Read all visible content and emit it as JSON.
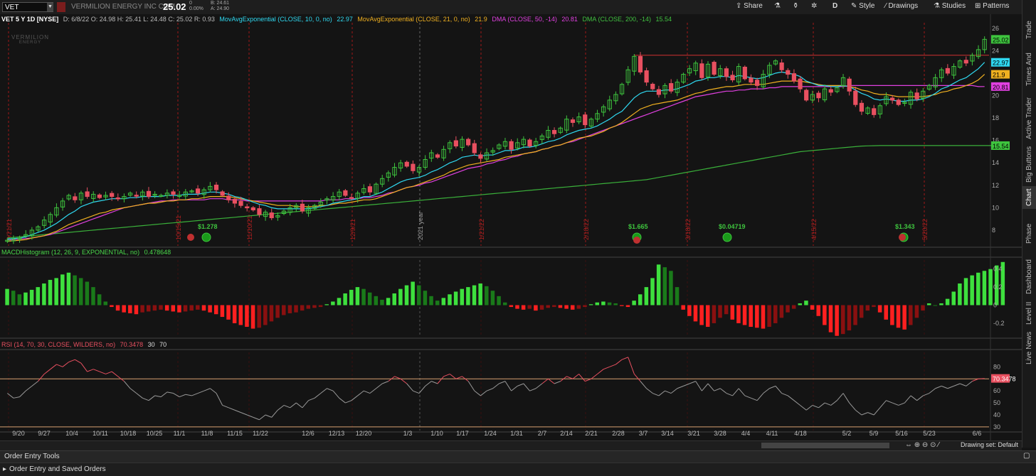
{
  "toolbar": {
    "symbol": "VET",
    "company": "VERMILION ENERGY INC COM",
    "last": "25.02",
    "change": "0",
    "change_pct": "0.00%",
    "bid": "B: 24.61",
    "ask": "A: 24.90",
    "share": "Share",
    "period": "D",
    "style": "Style",
    "drawings": "Drawings",
    "studies": "Studies",
    "patterns": "Patterns"
  },
  "right_tabs": [
    "Trade",
    "Times And Sales",
    "Active Trader",
    "Big Buttons",
    "Chart",
    "Phase Scores",
    "Dashboard",
    "Level II",
    "Live News"
  ],
  "price_header": {
    "title": "VET 5 Y 1D [NYSE]",
    "ohlc": "D: 6/8/22  O: 24.98  H: 25.41  L: 24.48  C: 25.02  R: 0.93",
    "ema10": {
      "label": "MovAvgExponential (CLOSE, 10, 0, no)",
      "value": "22.97",
      "color": "#2fd8f0"
    },
    "ema21": {
      "label": "MovAvgExponential (CLOSE, 21, 0, no)",
      "value": "21.9",
      "color": "#f0b020"
    },
    "dma50": {
      "label": "DMA (CLOSE, 50, -14)",
      "value": "20.81",
      "color": "#e040e0"
    },
    "dma200": {
      "label": "DMA (CLOSE, 200, -14)",
      "value": "15.54",
      "color": "#40c040"
    }
  },
  "macd_header": {
    "label": "MACDHistogram (12, 26, 9, EXPONENTIAL, no)",
    "value": "0.478648"
  },
  "rsi_header": {
    "label": "RSI (14, 70, 30, CLOSE, WILDERS, no)",
    "value": "70.3478",
    "ob": "30",
    "os": "70"
  },
  "watermark": {
    "line1": "VERMILION",
    "line2": "ENERGY"
  },
  "colors": {
    "up": "#3ec43e",
    "down": "#e85060",
    "bg": "#141414",
    "grid": "#2a2a2a",
    "marker": "#a01818"
  },
  "chart_data": {
    "type": "candlestick",
    "price_axis": [
      8,
      10,
      12,
      14,
      16,
      18,
      20,
      22,
      24,
      26
    ],
    "price_ylim": [
      6.6,
      26.5
    ],
    "last_price_label": "25.02",
    "resistance_line": 23.6,
    "x_ticks": [
      "9/20",
      "9/27",
      "10/4",
      "10/11",
      "10/18",
      "10/25",
      "11/1",
      "11/8",
      "11/15",
      "11/22",
      "12/6",
      "12/13",
      "12/20",
      "1/3",
      "1/10",
      "1/17",
      "1/24",
      "1/31",
      "2/7",
      "2/14",
      "2/21",
      "2/28",
      "3/7",
      "3/14",
      "3/21",
      "3/28",
      "4/4",
      "4/11",
      "4/18",
      "5/2",
      "5/9",
      "5/16",
      "5/23",
      "6/6"
    ],
    "vertical_markers": [
      "9/21/21",
      "10/15/21",
      "11/10/21",
      "12/9/21",
      "2021 year",
      "1/21/22",
      "2/18/22",
      "3/18/22",
      "4/15/22",
      "5/20/22"
    ],
    "dividends": [
      "$1.278",
      "$1.665",
      "$0.04719",
      "$1.343"
    ],
    "closes": [
      7.1,
      7.2,
      7.3,
      7.6,
      8.0,
      8.3,
      8.9,
      9.4,
      10.0,
      10.6,
      11.1,
      10.7,
      11.3,
      11.0,
      11.2,
      10.9,
      11.1,
      11.0,
      10.8,
      11.0,
      11.3,
      11.1,
      11.4,
      11.0,
      11.2,
      11.1,
      11.3,
      11.2,
      11.1,
      11.4,
      11.5,
      11.3,
      11.6,
      11.9,
      11.6,
      11.1,
      10.7,
      10.4,
      10.2,
      10.0,
      9.8,
      9.4,
      9.6,
      9.1,
      9.3,
      9.7,
      10.0,
      10.2,
      9.7,
      10.0,
      10.2,
      10.5,
      10.8,
      11.0,
      11.4,
      11.1,
      10.9,
      11.3,
      11.7,
      11.4,
      12.1,
      12.6,
      13.1,
      13.6,
      14.0,
      13.7,
      13.3,
      13.6,
      14.3,
      14.9,
      14.5,
      15.2,
      15.8,
      15.5,
      16.1,
      15.6,
      14.9,
      14.4,
      14.9,
      15.1,
      15.6,
      15.9,
      15.2,
      15.8,
      16.1,
      15.5,
      15.9,
      16.4,
      16.9,
      16.6,
      17.1,
      17.9,
      17.6,
      18.1,
      17.4,
      17.9,
      18.4,
      19.0,
      19.6,
      20.1,
      21.0,
      22.3,
      23.5,
      22.1,
      21.2,
      20.6,
      20.1,
      20.9,
      20.4,
      21.2,
      21.9,
      22.4,
      22.9,
      21.6,
      22.8,
      21.9,
      22.4,
      21.7,
      21.4,
      22.6,
      21.5,
      21.2,
      20.9,
      21.9,
      22.7,
      23.1,
      22.3,
      21.9,
      21.3,
      20.6,
      19.6,
      20.1,
      19.8,
      20.6,
      20.3,
      20.7,
      21.6,
      20.4,
      19.2,
      18.6,
      18.9,
      18.3,
      19.1,
      19.9,
      19.6,
      19.2,
      19.4,
      20.3,
      19.7,
      20.4,
      20.9,
      21.6,
      22.3,
      22.0,
      22.6,
      23.1,
      22.9,
      23.6,
      24.1,
      25.02
    ],
    "ema10": [
      7.2,
      7.25,
      7.3,
      7.4,
      7.6,
      7.8,
      8.0,
      8.3,
      8.6,
      9.0,
      9.4,
      9.7,
      10.1,
      10.3,
      10.5,
      10.6,
      10.7,
      10.8,
      10.8,
      10.8,
      10.9,
      10.9,
      11.0,
      11.0,
      11.0,
      11.0,
      11.1,
      11.1,
      11.1,
      11.2,
      11.2,
      11.2,
      11.3,
      11.4,
      11.4,
      11.3,
      11.2,
      11.0,
      10.9,
      10.7,
      10.5,
      10.3,
      10.2,
      10.0,
      9.9,
      9.9,
      9.9,
      9.9,
      9.9,
      9.9,
      10.0,
      10.1,
      10.2,
      10.4,
      10.5,
      10.6,
      10.7,
      10.8,
      11.0,
      11.0,
      11.2,
      11.4,
      11.7,
      12.0,
      12.3,
      12.5,
      12.6,
      12.7,
      12.9,
      13.2,
      13.4,
      13.7,
      14.0,
      14.2,
      14.5,
      14.6,
      14.7,
      14.6,
      14.7,
      14.7,
      14.9,
      15.1,
      15.1,
      15.2,
      15.4,
      15.4,
      15.5,
      15.7,
      15.9,
      16.0,
      16.2,
      16.5,
      16.7,
      16.9,
      17.0,
      17.1,
      17.3,
      17.6,
      17.9,
      18.3,
      18.6,
      19.2,
      19.8,
      20.2,
      20.4,
      20.4,
      20.4,
      20.5,
      20.5,
      20.6,
      20.8,
      21.0,
      21.3,
      21.4,
      21.6,
      21.6,
      21.7,
      21.7,
      21.6,
      21.8,
      21.7,
      21.6,
      21.5,
      21.6,
      21.8,
      22.0,
      22.1,
      22.0,
      21.9,
      21.7,
      21.3,
      21.1,
      20.9,
      20.9,
      20.8,
      20.8,
      20.9,
      20.8,
      20.5,
      20.2,
      20.0,
      19.7,
      19.6,
      19.7,
      19.6,
      19.5,
      19.5,
      19.6,
      19.6,
      19.7,
      19.9,
      20.2,
      20.6,
      20.8,
      21.1,
      21.4,
      21.6,
      22.0,
      22.4,
      22.97
    ],
    "ema21": [
      7.0,
      7.05,
      7.1,
      7.15,
      7.3,
      7.4,
      7.5,
      7.7,
      7.9,
      8.2,
      8.5,
      8.7,
      8.9,
      9.1,
      9.3,
      9.5,
      9.6,
      9.8,
      9.9,
      10.0,
      10.1,
      10.2,
      10.3,
      10.4,
      10.4,
      10.5,
      10.6,
      10.6,
      10.7,
      10.7,
      10.8,
      10.8,
      10.9,
      11.0,
      11.0,
      11.0,
      11.0,
      10.9,
      10.8,
      10.7,
      10.6,
      10.5,
      10.4,
      10.3,
      10.2,
      10.2,
      10.2,
      10.1,
      10.1,
      10.1,
      10.1,
      10.2,
      10.2,
      10.3,
      10.4,
      10.4,
      10.5,
      10.6,
      10.7,
      10.7,
      10.8,
      11.0,
      11.2,
      11.4,
      11.6,
      11.8,
      11.9,
      12.1,
      12.3,
      12.5,
      12.7,
      12.9,
      13.2,
      13.4,
      13.6,
      13.8,
      13.9,
      14.0,
      14.1,
      14.2,
      14.3,
      14.5,
      14.6,
      14.7,
      14.8,
      14.9,
      15.0,
      15.2,
      15.3,
      15.5,
      15.6,
      15.8,
      16.0,
      16.2,
      16.3,
      16.4,
      16.6,
      16.8,
      17.1,
      17.3,
      17.6,
      18.0,
      18.4,
      18.8,
      19.0,
      19.2,
      19.3,
      19.4,
      19.5,
      19.6,
      19.8,
      20.0,
      20.2,
      20.3,
      20.5,
      20.6,
      20.7,
      20.8,
      20.8,
      20.9,
      21.0,
      21.0,
      21.0,
      21.0,
      21.1,
      21.2,
      21.3,
      21.3,
      21.3,
      21.3,
      21.2,
      21.1,
      21.0,
      20.9,
      20.9,
      20.9,
      20.9,
      20.8,
      20.7,
      20.5,
      20.4,
      20.2,
      20.1,
      20.1,
      20.0,
      19.9,
      19.9,
      19.9,
      19.9,
      19.9,
      20.0,
      20.1,
      20.3,
      20.4,
      20.6,
      20.7,
      20.9,
      21.1,
      21.4,
      21.9
    ],
    "dma50": [
      7.1,
      7.15,
      7.2,
      7.25,
      7.3,
      7.4,
      7.5,
      7.6,
      7.8,
      8.0,
      8.2,
      8.4,
      8.6,
      8.8,
      9.0,
      9.2,
      9.4,
      9.6,
      9.8,
      10.0,
      10.1,
      10.2,
      10.3,
      10.4,
      10.5,
      10.6,
      10.6,
      10.7,
      10.7,
      10.7,
      10.7,
      10.7,
      10.7,
      10.8,
      10.8,
      10.8,
      10.7,
      10.7,
      10.7,
      10.6,
      10.6,
      10.6,
      10.6,
      10.6,
      10.6,
      10.6,
      10.6,
      10.6,
      10.6,
      10.6,
      10.6,
      10.6,
      10.7,
      10.7,
      10.7,
      10.8,
      10.8,
      10.8,
      10.9,
      10.9,
      11.0,
      11.1,
      11.3,
      11.4,
      11.6,
      11.8,
      11.9,
      12.0,
      12.2,
      12.3,
      12.5,
      12.7,
      12.9,
      13.1,
      13.3,
      13.5,
      13.6,
      13.7,
      13.9,
      14.0,
      14.2,
      14.3,
      14.5,
      14.6,
      14.8,
      14.9,
      15.0,
      15.2,
      15.3,
      15.5,
      15.6,
      15.8,
      15.9,
      16.1,
      16.3,
      16.5,
      16.7,
      16.9,
      17.1,
      17.3,
      17.5,
      17.7,
      17.9,
      18.1,
      18.3,
      18.5,
      18.7,
      18.9,
      19.1,
      19.3,
      19.5,
      19.7,
      19.9,
      20.0,
      20.1,
      20.2,
      20.3,
      20.4,
      20.4,
      20.5,
      20.5,
      20.6,
      20.6,
      20.6,
      20.7,
      20.7,
      20.8,
      20.8,
      20.8,
      20.8,
      20.8,
      20.8,
      20.8,
      20.8,
      20.8,
      20.8,
      20.8,
      20.9,
      20.9,
      20.9,
      20.9,
      20.9,
      20.9,
      20.9,
      20.9,
      20.9,
      20.9,
      20.9,
      20.9,
      20.9,
      20.9,
      20.9,
      20.9,
      20.9,
      20.9,
      20.9,
      20.9,
      20.9,
      20.8,
      20.81
    ],
    "dma200": [
      7.3,
      7.35,
      7.4,
      7.45,
      7.5,
      7.55,
      7.6,
      7.65,
      7.7,
      7.75,
      7.8,
      7.85,
      7.9,
      7.95,
      8.0,
      8.05,
      8.1,
      8.15,
      8.2,
      8.25,
      8.3,
      8.35,
      8.4,
      8.45,
      8.5,
      8.55,
      8.6,
      8.65,
      8.7,
      8.75,
      8.8,
      8.85,
      8.9,
      8.95,
      9.0,
      9.05,
      9.1,
      9.15,
      9.2,
      9.25,
      9.3,
      9.35,
      9.4,
      9.45,
      9.5,
      9.55,
      9.6,
      9.65,
      9.7,
      9.75,
      9.8,
      9.85,
      9.9,
      9.95,
      10.0,
      10.05,
      10.1,
      10.15,
      10.2,
      10.25,
      10.3,
      10.35,
      10.4,
      10.45,
      10.5,
      10.55,
      10.6,
      10.65,
      10.7,
      10.75,
      10.8,
      10.85,
      10.9,
      10.95,
      11.0,
      11.05,
      11.1,
      11.15,
      11.2,
      11.25,
      11.3,
      11.35,
      11.4,
      11.45,
      11.5,
      11.55,
      11.6,
      11.65,
      11.7,
      11.75,
      11.8,
      11.85,
      11.9,
      11.95,
      12.0,
      12.05,
      12.1,
      12.15,
      12.2,
      12.25,
      12.3,
      12.35,
      12.4,
      12.45,
      12.5,
      12.6,
      12.7,
      12.8,
      12.9,
      13.0,
      13.1,
      13.2,
      13.3,
      13.4,
      13.5,
      13.6,
      13.7,
      13.8,
      13.9,
      14.0,
      14.1,
      14.2,
      14.3,
      14.4,
      14.5,
      14.6,
      14.7,
      14.8,
      14.9,
      15.0,
      15.05,
      15.1,
      15.15,
      15.2,
      15.25,
      15.3,
      15.35,
      15.4,
      15.45,
      15.5,
      15.52,
      15.53,
      15.54,
      15.54,
      15.54,
      15.54,
      15.54,
      15.54,
      15.54,
      15.54,
      15.54,
      15.54,
      15.54,
      15.54,
      15.54,
      15.54,
      15.54,
      15.54,
      15.54,
      15.54,
      15.54,
      15.54
    ],
    "macd_axis": [
      0.4,
      0.2,
      0,
      -0.2
    ],
    "macd_ylim": [
      -0.35,
      0.5
    ],
    "macd_last": "0.478648",
    "macd_hist": [
      0.18,
      0.16,
      0.12,
      0.14,
      0.17,
      0.2,
      0.24,
      0.28,
      0.3,
      0.34,
      0.36,
      0.33,
      0.3,
      0.26,
      0.2,
      0.12,
      0.04,
      -0.02,
      -0.06,
      -0.08,
      -0.09,
      -0.1,
      -0.08,
      -0.07,
      -0.06,
      -0.05,
      -0.06,
      -0.07,
      -0.08,
      -0.07,
      -0.06,
      -0.05,
      -0.06,
      -0.08,
      -0.1,
      -0.13,
      -0.16,
      -0.2,
      -0.22,
      -0.24,
      -0.26,
      -0.25,
      -0.22,
      -0.18,
      -0.14,
      -0.11,
      -0.09,
      -0.08,
      -0.06,
      -0.04,
      -0.03,
      -0.02,
      0.01,
      0.04,
      0.08,
      0.13,
      0.17,
      0.2,
      0.18,
      0.14,
      0.1,
      0.06,
      0.08,
      0.13,
      0.18,
      0.22,
      0.26,
      0.22,
      0.16,
      0.1,
      0.05,
      0.08,
      0.12,
      0.15,
      0.18,
      0.2,
      0.22,
      0.24,
      0.21,
      0.16,
      0.1,
      0.03,
      -0.02,
      -0.04,
      -0.05,
      -0.04,
      -0.06,
      -0.05,
      -0.03,
      -0.02,
      -0.03,
      -0.04,
      -0.05,
      -0.04,
      -0.02,
      0.01,
      0.03,
      0.04,
      0.03,
      0.02,
      -0.01,
      -0.02,
      0.05,
      0.12,
      0.2,
      0.3,
      0.45,
      0.42,
      0.38,
      0.2,
      -0.05,
      -0.12,
      -0.18,
      -0.22,
      -0.24,
      -0.2,
      -0.14,
      -0.1,
      -0.16,
      -0.2,
      -0.22,
      -0.24,
      -0.25,
      -0.26,
      -0.24,
      -0.2,
      -0.14,
      -0.08,
      -0.04,
      0.02,
      0.05,
      -0.05,
      -0.12,
      -0.22,
      -0.3,
      -0.34,
      -0.32,
      -0.28,
      -0.22,
      -0.14,
      -0.06,
      -0.02,
      -0.08,
      -0.16,
      -0.22,
      -0.25,
      -0.27,
      -0.22,
      -0.14,
      -0.06,
      0.02,
      0.0,
      0.02,
      0.07,
      0.15,
      0.24,
      0.3,
      0.33,
      0.36,
      0.38,
      0.4,
      0.44,
      0.478
    ],
    "rsi_axis": [
      80,
      70,
      60,
      50,
      40,
      30
    ],
    "rsi_ylim": [
      27,
      92
    ],
    "rsi_last": "70.3478",
    "rsi": [
      58,
      54,
      55,
      60,
      64,
      68,
      74,
      78,
      82,
      80,
      84,
      86,
      83,
      76,
      78,
      76,
      74,
      76,
      72,
      68,
      62,
      58,
      54,
      52,
      56,
      55,
      59,
      58,
      55,
      57,
      56,
      58,
      60,
      62,
      58,
      48,
      46,
      44,
      42,
      40,
      38,
      36,
      40,
      38,
      44,
      48,
      46,
      50,
      46,
      52,
      54,
      58,
      62,
      60,
      54,
      50,
      52,
      56,
      60,
      58,
      62,
      66,
      68,
      72,
      70,
      66,
      60,
      58,
      64,
      68,
      66,
      72,
      74,
      70,
      72,
      68,
      60,
      56,
      60,
      62,
      66,
      68,
      60,
      64,
      66,
      60,
      62,
      66,
      70,
      66,
      68,
      72,
      70,
      74,
      68,
      70,
      74,
      78,
      80,
      82,
      86,
      88,
      74,
      68,
      62,
      58,
      56,
      60,
      58,
      62,
      64,
      66,
      68,
      60,
      66,
      60,
      62,
      58,
      56,
      62,
      56,
      54,
      52,
      58,
      62,
      64,
      58,
      56,
      52,
      48,
      44,
      48,
      46,
      50,
      48,
      52,
      58,
      50,
      44,
      40,
      42,
      40,
      46,
      52,
      50,
      48,
      50,
      56,
      52,
      56,
      58,
      62,
      64,
      62,
      64,
      66,
      64,
      68,
      70,
      70.3
    ]
  }
}
